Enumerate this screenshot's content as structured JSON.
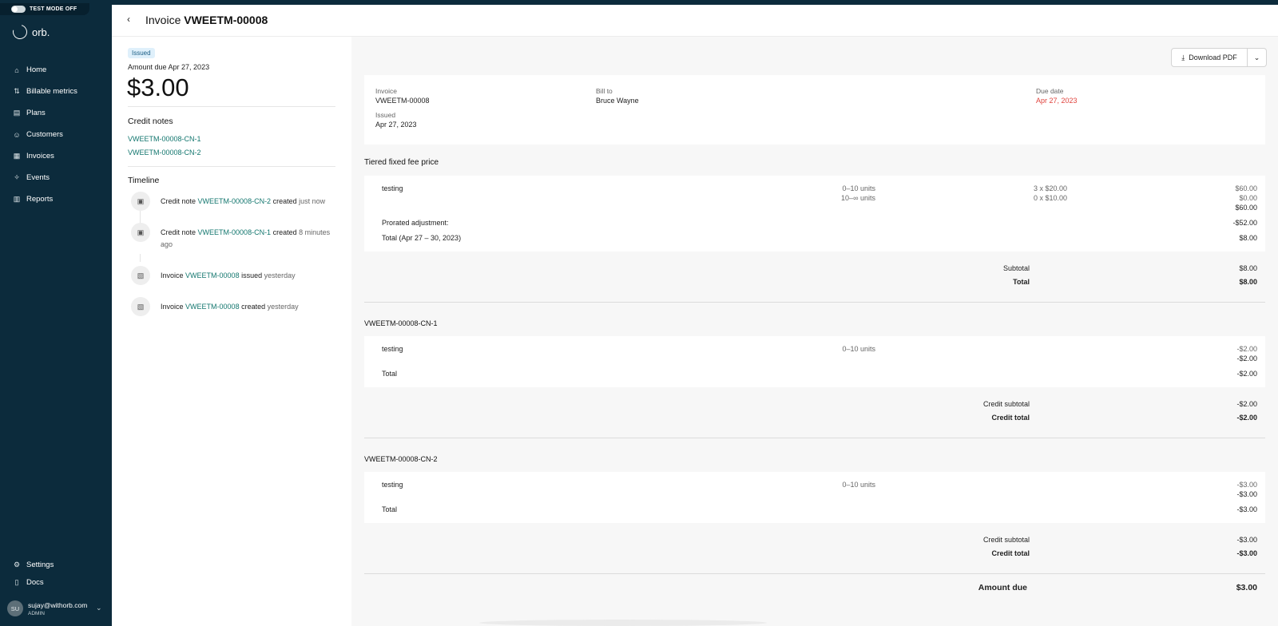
{
  "test_mode": {
    "label": "TEST MODE OFF"
  },
  "brand": {
    "name": "orb."
  },
  "nav": {
    "items": [
      {
        "label": "Home",
        "icon": "home-icon",
        "glyph": "⌂"
      },
      {
        "label": "Billable metrics",
        "icon": "sort-icon",
        "glyph": "⇅"
      },
      {
        "label": "Plans",
        "icon": "plans-icon",
        "glyph": "▤"
      },
      {
        "label": "Customers",
        "icon": "customers-icon",
        "glyph": "☺"
      },
      {
        "label": "Invoices",
        "icon": "invoice-icon",
        "glyph": "▦"
      },
      {
        "label": "Events",
        "icon": "events-icon",
        "glyph": "✧"
      },
      {
        "label": "Reports",
        "icon": "reports-icon",
        "glyph": "▥"
      }
    ],
    "bottom": [
      {
        "label": "Settings",
        "icon": "gear-icon",
        "glyph": "⚙"
      },
      {
        "label": "Docs",
        "icon": "book-icon",
        "glyph": "▯"
      }
    ]
  },
  "user": {
    "initials": "SU",
    "email": "sujay@withorb.com",
    "role": "ADMIN"
  },
  "header": {
    "back": "‹",
    "title_prefix": "Invoice",
    "title_id": "VWEETM-00008"
  },
  "summary": {
    "status": "Issued",
    "amount_label": "Amount due Apr 27, 2023",
    "amount": "$3.00",
    "credit_notes_title": "Credit notes",
    "credit_notes": [
      "VWEETM-00008-CN-1",
      "VWEETM-00008-CN-2"
    ],
    "timeline_title": "Timeline",
    "timeline": [
      {
        "prefix": "Credit note",
        "link": "VWEETM-00008-CN-2",
        "action": "created",
        "time": "just now"
      },
      {
        "prefix": "Credit note",
        "link": "VWEETM-00008-CN-1",
        "action": "created",
        "time": "8 minutes ago"
      },
      {
        "prefix": "Invoice",
        "link": "VWEETM-00008",
        "action": "issued",
        "time": "yesterday"
      },
      {
        "prefix": "Invoice",
        "link": "VWEETM-00008",
        "action": "created",
        "time": "yesterday"
      }
    ]
  },
  "actions": {
    "download": "Download PDF",
    "caret": "⌄"
  },
  "details": {
    "invoice_label": "Invoice",
    "invoice_value": "VWEETM-00008",
    "issued_label": "Issued",
    "issued_value": "Apr 27, 2023",
    "bill_to_label": "Bill to",
    "bill_to_value": "Bruce Wayne",
    "due_label": "Due date",
    "due_value": "Apr 27, 2023"
  },
  "tiered": {
    "heading": "Tiered fixed fee price",
    "item": "testing",
    "tiers": [
      {
        "units": "0–10 units",
        "calc": "3 x $20.00",
        "amount": "$60.00"
      },
      {
        "units": "10–∞ units",
        "calc": "0 x $10.00",
        "amount": "$0.00"
      }
    ],
    "line_total": "$60.00",
    "prorated_label": "Prorated adjustment:",
    "prorated_value": "-$52.00",
    "total_label": "Total (Apr 27 – 30, 2023)",
    "total_value": "$8.00",
    "subtotal_label": "Subtotal",
    "subtotal_value": "$8.00",
    "grand_label": "Total",
    "grand_value": "$8.00"
  },
  "credit_notes": [
    {
      "id": "VWEETM-00008-CN-1",
      "item": "testing",
      "units": "0–10 units",
      "amount": "-$2.00",
      "line_total": "-$2.00",
      "total_label": "Total",
      "total": "-$2.00",
      "subtotal_label": "Credit subtotal",
      "subtotal": "-$2.00",
      "credit_total_label": "Credit total",
      "credit_total": "-$2.00"
    },
    {
      "id": "VWEETM-00008-CN-2",
      "item": "testing",
      "units": "0–10 units",
      "amount": "-$3.00",
      "line_total": "-$3.00",
      "total_label": "Total",
      "total": "-$3.00",
      "subtotal_label": "Credit subtotal",
      "subtotal": "-$3.00",
      "credit_total_label": "Credit total",
      "credit_total": "-$3.00"
    }
  ],
  "amount_due": {
    "label": "Amount due",
    "value": "$3.00"
  }
}
